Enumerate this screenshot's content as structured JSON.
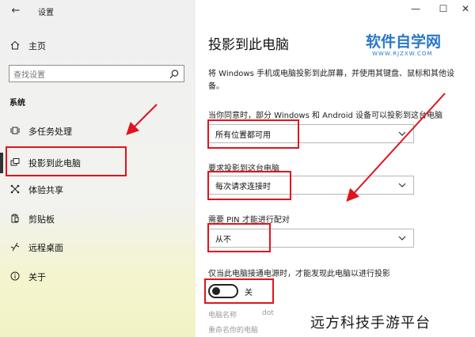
{
  "window": {
    "title": "设置",
    "minimize_glyph": "—",
    "maximize_glyph": "☐",
    "close_glyph": "✕"
  },
  "sidebar": {
    "home_label": "主页",
    "search_placeholder": "查找设置",
    "section_title": "系统",
    "items": [
      {
        "label": "多任务处理",
        "icon": "multitask-icon"
      },
      {
        "label": "投影到此电脑",
        "icon": "project-icon",
        "selected": true
      },
      {
        "label": "体验共享",
        "icon": "share-icon"
      },
      {
        "label": "剪贴板",
        "icon": "clipboard-icon"
      },
      {
        "label": "远程桌面",
        "icon": "remote-desktop-icon"
      },
      {
        "label": "关于",
        "icon": "info-icon"
      }
    ]
  },
  "main": {
    "title": "投影到此电脑",
    "description": "将 Windows 手机或电脑投影到此屏幕，并使用其键盘、鼠标和其他设备。",
    "setting1": {
      "label": "当你同意时，部分 Windows 和 Android 设备可以投影到这台电脑",
      "value": "所有位置都可用"
    },
    "setting2": {
      "label": "要求投影到这台电脑",
      "value": "每次请求连接时"
    },
    "setting3": {
      "label": "需要 PIN 才能进行配对",
      "value": "从不"
    },
    "setting4": {
      "label": "仅当此电脑接通电源时，才能发现此电脑以进行投影",
      "toggle_state": "关"
    },
    "pc_name_label": "电脑名称",
    "pc_name_value": "dot",
    "rename_label": "重命名你的电脑"
  },
  "branding": {
    "logo": "软件自学网",
    "logo_url": "WWW.RJZXW.COM",
    "watermark": "远方科技手游平台"
  },
  "colors": {
    "highlight": "#e0141e",
    "logo": "#2a78c8"
  }
}
